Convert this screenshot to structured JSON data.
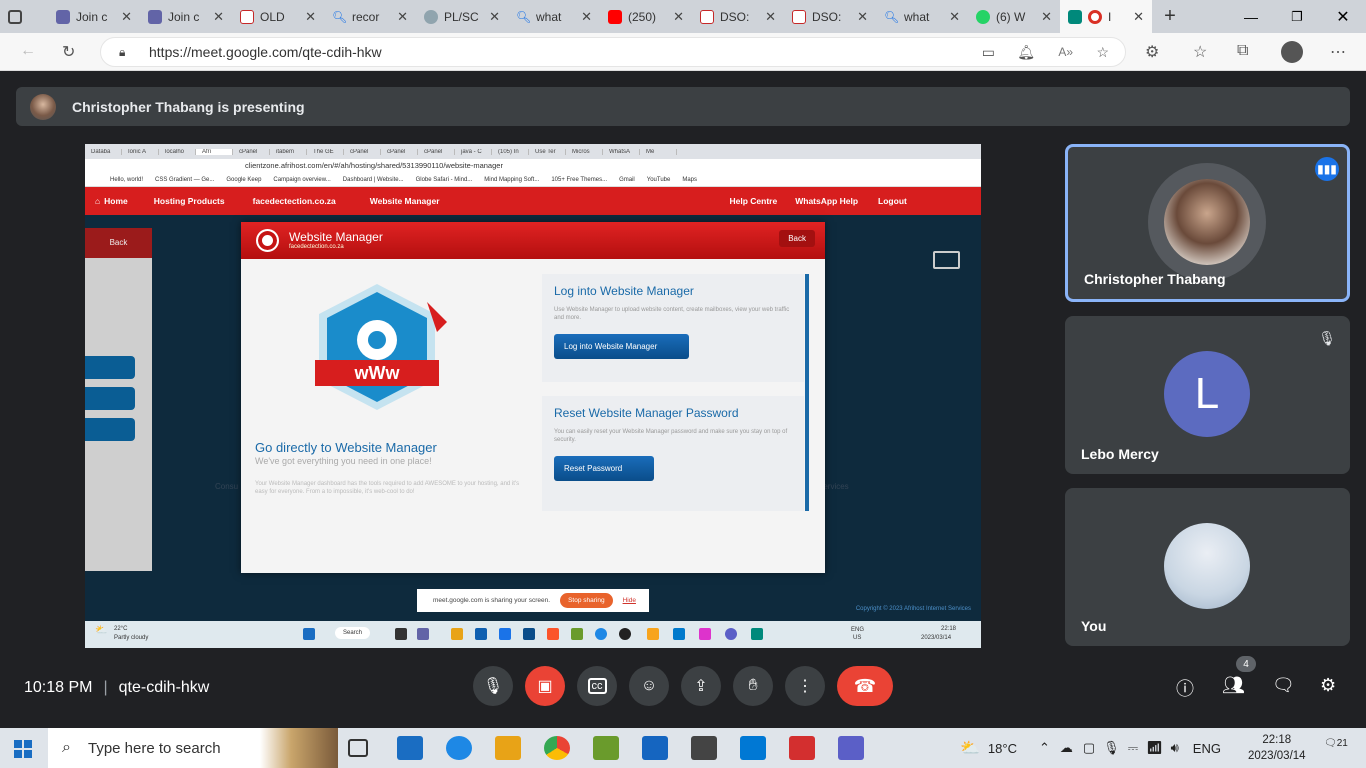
{
  "browser": {
    "tabs": [
      {
        "label": "",
        "color": "#555",
        "icon": "window-icon"
      },
      {
        "label": "Join c",
        "color": "#6264a7"
      },
      {
        "label": "Join c",
        "color": "#6264a7"
      },
      {
        "label": "OLD",
        "color": "#c62828"
      },
      {
        "label": "recor",
        "color": "#1a73e8"
      },
      {
        "label": "PL/SC",
        "color": "#90a4ae"
      },
      {
        "label": "what",
        "color": "#1a73e8"
      },
      {
        "label": "(250)",
        "color": "#ff0000"
      },
      {
        "label": "DSO:",
        "color": "#c62828"
      },
      {
        "label": "DSO:",
        "color": "#c62828"
      },
      {
        "label": "what",
        "color": "#1a73e8"
      },
      {
        "label": "(6) W",
        "color": "#25d366"
      },
      {
        "label": "I",
        "color": "#00897b"
      }
    ],
    "url": "https://meet.google.com/qte-cdih-hkw"
  },
  "meet": {
    "presenter_text": "Christopher Thabang is presenting",
    "time": "10:18 PM",
    "meeting_code": "qte-cdih-hkw",
    "participant_count": "4",
    "participants": [
      {
        "name": "Christopher Thabang"
      },
      {
        "name": "Lebo Mercy",
        "initial": "L"
      },
      {
        "name": "You"
      }
    ]
  },
  "shared": {
    "tabs": [
      "Databa",
      "Ionic A",
      "localho",
      "Afri",
      "cPanel",
      "itabem",
      "The GE",
      "cPanel",
      "cPanel",
      "cPanel",
      "java - C",
      "(105) In",
      "Use Ter",
      "Micros",
      "WhatsA",
      "Me"
    ],
    "url": "clientzone.afrihost.com/en/#/ah/hosting/shared/5313990110/website-manager",
    "bookmarks": [
      "Hello, world!",
      "CSS Gradient — Ge...",
      "Google Keep",
      "Campaign overview...",
      "Dashboard | Website...",
      "Globe Safari - Mind...",
      "Mind Mapping Soft...",
      "105+ Free Themes...",
      "Gmail",
      "YouTube",
      "Maps"
    ],
    "nav": [
      "Home",
      "Hosting Products",
      "facedectection.co.za",
      "Website Manager"
    ],
    "nav_right": [
      "Help Centre",
      "WhatsApp Help",
      "Logout"
    ],
    "side_back": "Back",
    "modal_title": "Website Manager",
    "modal_subtitle": "facedectection.co.za",
    "modal_back": "Back",
    "www": "wWw",
    "go_title": "Go directly to Website Manager",
    "go_sub": "We've got everything you need in one place!",
    "go_desc": "Your Website Manager dashboard has the tools required to add AWESOME to your hosting, and it's easy for everyone. From a to impossible, it's web-cool to do!",
    "card1_title": "Log into Website Manager",
    "card1_desc": "Use Website Manager to upload website content, create mailboxes, view your web traffic and more.",
    "card1_btn": "Log into Website Manager",
    "card2_title": "Reset Website Manager Password",
    "card2_desc": "You can easily reset your Website Manager password and make sure you stay on top of security.",
    "card2_btn": "Reset Password",
    "sharing_text": "meet.google.com is sharing your screen.",
    "stop_sharing": "Stop sharing",
    "hide": "Hide",
    "copyright": "Copyright © 2023 Afrihost Internet Services",
    "weather_temp": "22°C",
    "weather_desc": "Partly cloudy",
    "search": "Search",
    "lang1": "ENG",
    "lang2": "US",
    "time": "22:18",
    "date": "2023/03/14",
    "bg_left": "Consu",
    "bg_right": "Services"
  },
  "taskbar": {
    "search_placeholder": "Type here to search",
    "temp": "18°C",
    "lang": "ENG",
    "time": "22:18",
    "date": "2023/03/14",
    "notif": "21"
  }
}
